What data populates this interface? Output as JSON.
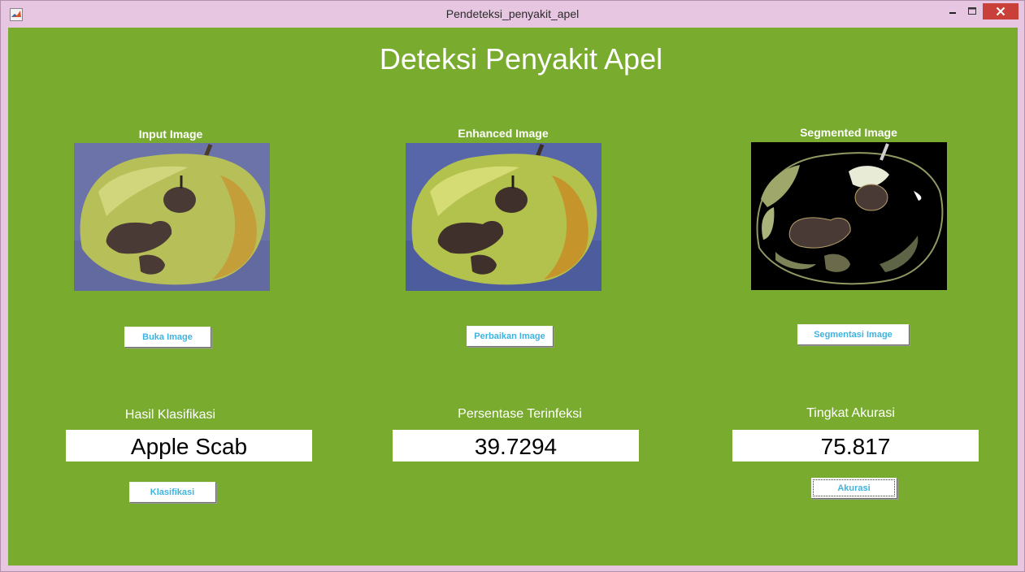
{
  "window": {
    "title": "Pendeteksi_penyakit_apel"
  },
  "header": {
    "title": "Deteksi Penyakit Apel"
  },
  "panels": [
    {
      "caption": "Input Image",
      "button": "Buka Image"
    },
    {
      "caption": "Enhanced Image",
      "button": "Perbaikan Image"
    },
    {
      "caption": "Segmented Image",
      "button": "Segmentasi Image"
    }
  ],
  "results": [
    {
      "label": "Hasil Klasifikasi",
      "value": "Apple Scab",
      "button": "Klasifikasi"
    },
    {
      "label": "Persentase Terinfeksi",
      "value": "39.7294"
    },
    {
      "label": "Tingkat Akurasi",
      "value": "75.817",
      "button": "Akurasi"
    }
  ],
  "colors": {
    "panel_bg": "#79ab2f",
    "window_frame": "#e6c6e0",
    "button_text": "#3fb3e0",
    "close_button": "#c9403a"
  }
}
